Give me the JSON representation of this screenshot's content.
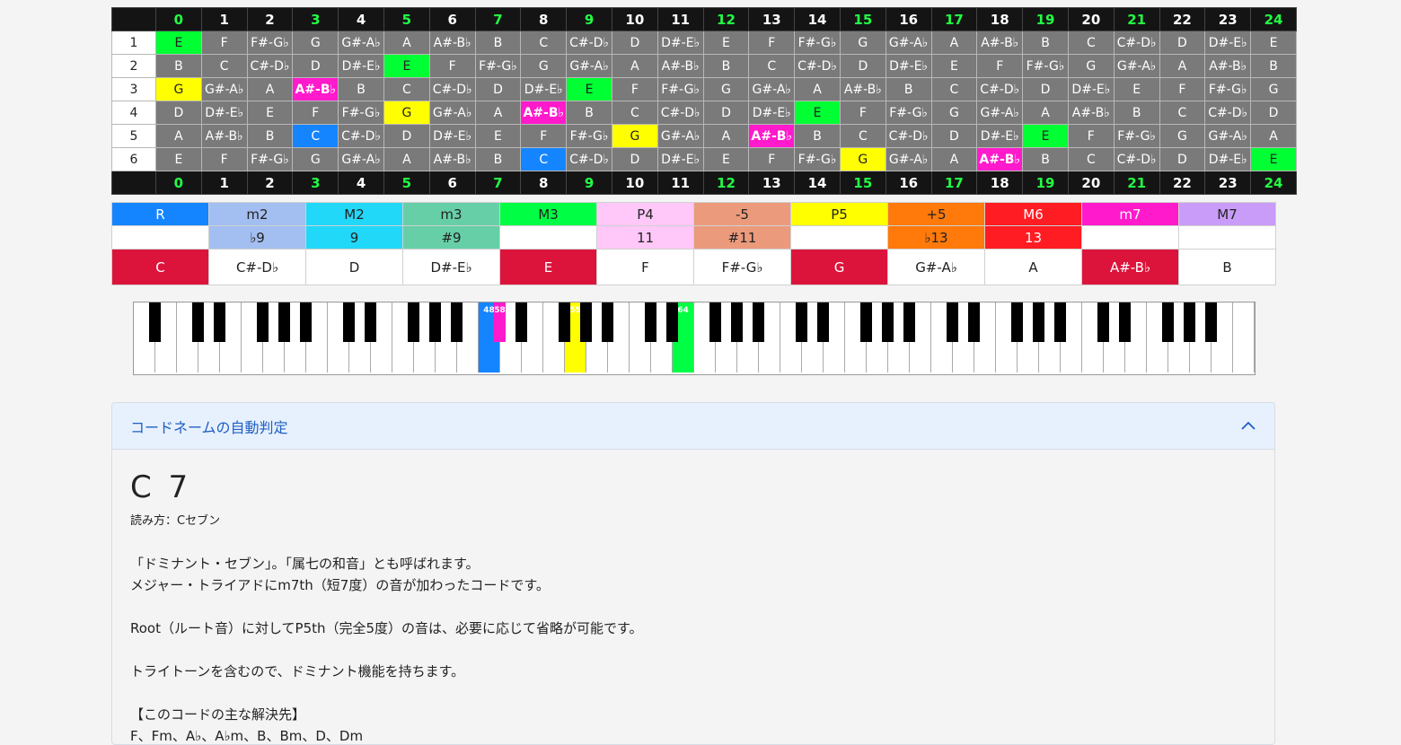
{
  "fret_header": [
    "0",
    "1",
    "2",
    "3",
    "4",
    "5",
    "6",
    "7",
    "8",
    "9",
    "10",
    "11",
    "12",
    "13",
    "14",
    "15",
    "16",
    "17",
    "18",
    "19",
    "20",
    "21",
    "22",
    "23",
    "24"
  ],
  "fret_markers": [
    "0",
    "3",
    "5",
    "7",
    "9",
    "12",
    "15",
    "17",
    "19",
    "21",
    "24"
  ],
  "strings": [
    {
      "label": "1",
      "notes": [
        "E",
        "F",
        "F#-G♭",
        "G",
        "G#-A♭",
        "A",
        "A#-B♭",
        "B",
        "C",
        "C#-D♭",
        "D",
        "D#-E♭",
        "E",
        "F",
        "F#-G♭",
        "G",
        "G#-A♭",
        "A",
        "A#-B♭",
        "B",
        "C",
        "C#-D♭",
        "D",
        "D#-E♭",
        "E"
      ]
    },
    {
      "label": "2",
      "notes": [
        "B",
        "C",
        "C#-D♭",
        "D",
        "D#-E♭",
        "E",
        "F",
        "F#-G♭",
        "G",
        "G#-A♭",
        "A",
        "A#-B♭",
        "B",
        "C",
        "C#-D♭",
        "D",
        "D#-E♭",
        "E",
        "F",
        "F#-G♭",
        "G",
        "G#-A♭",
        "A",
        "A#-B♭",
        "B"
      ]
    },
    {
      "label": "3",
      "notes": [
        "G",
        "G#-A♭",
        "A",
        "A#-B♭",
        "B",
        "C",
        "C#-D♭",
        "D",
        "D#-E♭",
        "E",
        "F",
        "F#-G♭",
        "G",
        "G#-A♭",
        "A",
        "A#-B♭",
        "B",
        "C",
        "C#-D♭",
        "D",
        "D#-E♭",
        "E",
        "F",
        "F#-G♭",
        "G"
      ]
    },
    {
      "label": "4",
      "notes": [
        "D",
        "D#-E♭",
        "E",
        "F",
        "F#-G♭",
        "G",
        "G#-A♭",
        "A",
        "A#-B♭",
        "B",
        "C",
        "C#-D♭",
        "D",
        "D#-E♭",
        "E",
        "F",
        "F#-G♭",
        "G",
        "G#-A♭",
        "A",
        "A#-B♭",
        "B",
        "C",
        "C#-D♭",
        "D"
      ]
    },
    {
      "label": "5",
      "notes": [
        "A",
        "A#-B♭",
        "B",
        "C",
        "C#-D♭",
        "D",
        "D#-E♭",
        "E",
        "F",
        "F#-G♭",
        "G",
        "G#-A♭",
        "A",
        "A#-B♭",
        "B",
        "C",
        "C#-D♭",
        "D",
        "D#-E♭",
        "E",
        "F",
        "F#-G♭",
        "G",
        "G#-A♭",
        "A"
      ]
    },
    {
      "label": "6",
      "notes": [
        "E",
        "F",
        "F#-G♭",
        "G",
        "G#-A♭",
        "A",
        "A#-B♭",
        "B",
        "C",
        "C#-D♭",
        "D",
        "D#-E♭",
        "E",
        "F",
        "F#-G♭",
        "G",
        "G#-A♭",
        "A",
        "A#-B♭",
        "B",
        "C",
        "C#-D♭",
        "D",
        "D#-E♭",
        "E"
      ]
    }
  ],
  "highlights": [
    {
      "string": 0,
      "fret": 0,
      "role": "m3"
    },
    {
      "string": 1,
      "fret": 5,
      "role": "m3"
    },
    {
      "string": 2,
      "fret": 0,
      "role": "p5"
    },
    {
      "string": 2,
      "fret": 3,
      "role": "m7"
    },
    {
      "string": 2,
      "fret": 9,
      "role": "m3"
    },
    {
      "string": 3,
      "fret": 5,
      "role": "p5"
    },
    {
      "string": 3,
      "fret": 8,
      "role": "m7"
    },
    {
      "string": 3,
      "fret": 14,
      "role": "m3"
    },
    {
      "string": 4,
      "fret": 3,
      "role": "root"
    },
    {
      "string": 4,
      "fret": 10,
      "role": "p5"
    },
    {
      "string": 4,
      "fret": 13,
      "role": "m7"
    },
    {
      "string": 4,
      "fret": 19,
      "role": "m3"
    },
    {
      "string": 5,
      "fret": 8,
      "role": "root"
    },
    {
      "string": 5,
      "fret": 15,
      "role": "p5"
    },
    {
      "string": 5,
      "fret": 18,
      "role": "m7"
    },
    {
      "string": 5,
      "fret": 24,
      "role": "m3"
    }
  ],
  "intervals": {
    "names": [
      "R",
      "m2",
      "M2",
      "m3",
      "M3",
      "P4",
      "-5",
      "P5",
      "+5",
      "M6",
      "m7",
      "M7"
    ],
    "tensions": [
      "",
      "♭9",
      "9",
      "#9",
      "",
      "11",
      "#11",
      "",
      "♭13",
      "13",
      "",
      ""
    ],
    "colors": [
      "#1585ff",
      "#a3bef0",
      "#22d8f8",
      "#66cfa8",
      "#00ff44",
      "#ffc8f8",
      "#eb9a7c",
      "#ffff00",
      "#ff7a0a",
      "#ff1c22",
      "#ff1acc",
      "#c89cf8"
    ],
    "text_colors": [
      "#ffffff",
      "#222222",
      "#222222",
      "#222222",
      "#222222",
      "#222222",
      "#222222",
      "#222222",
      "#222222",
      "#ffffff",
      "#ffffff",
      "#222222"
    ],
    "notes": [
      "C",
      "C#-D♭",
      "D",
      "D#-E♭",
      "E",
      "F",
      "F#-G♭",
      "G",
      "G#-A♭",
      "A",
      "A#-B♭",
      "B"
    ],
    "active": [
      true,
      false,
      false,
      false,
      true,
      false,
      false,
      true,
      false,
      false,
      true,
      false
    ]
  },
  "piano": {
    "white_keys": 52,
    "highlighted": [
      {
        "key_type": "white",
        "index": 23,
        "label": "48",
        "color": "#1585ff"
      },
      {
        "key_type": "white",
        "index": 25,
        "label": "55",
        "color": "#ffff00"
      },
      {
        "key_type": "black",
        "index": 18,
        "label": "58",
        "color": "#ff1acc"
      },
      {
        "key_type": "white",
        "index": 25,
        "label": "",
        "color": ""
      },
      {
        "key_type": "white",
        "index": 25,
        "label": "",
        "color": ""
      },
      {
        "key_type": "white",
        "index": 25,
        "label": "",
        "color": ""
      }
    ],
    "e_key": {
      "label": "64",
      "color": "#00ff44"
    }
  },
  "accordion": {
    "title": "コードネームの自動判定",
    "chevron_icon": "chevron-up-icon"
  },
  "chord": {
    "name": "C 7",
    "reading": "読み方：Cセブン",
    "paragraphs": [
      "「ドミナント・セブン」。「属七の和音」とも呼ばれます。",
      "メジャー・トライアドにm7th（短7度）の音が加わったコードです。",
      "",
      "Root（ルート音）に対してP5th（完全5度）の音は、必要に応じて省略が可能です。",
      "",
      "トライトーンを含むので、ドミナント機能を持ちます。",
      "",
      "【このコードの主な解決先】",
      "F、Fm、A♭、A♭m、B、Bm、D、Dm"
    ]
  }
}
